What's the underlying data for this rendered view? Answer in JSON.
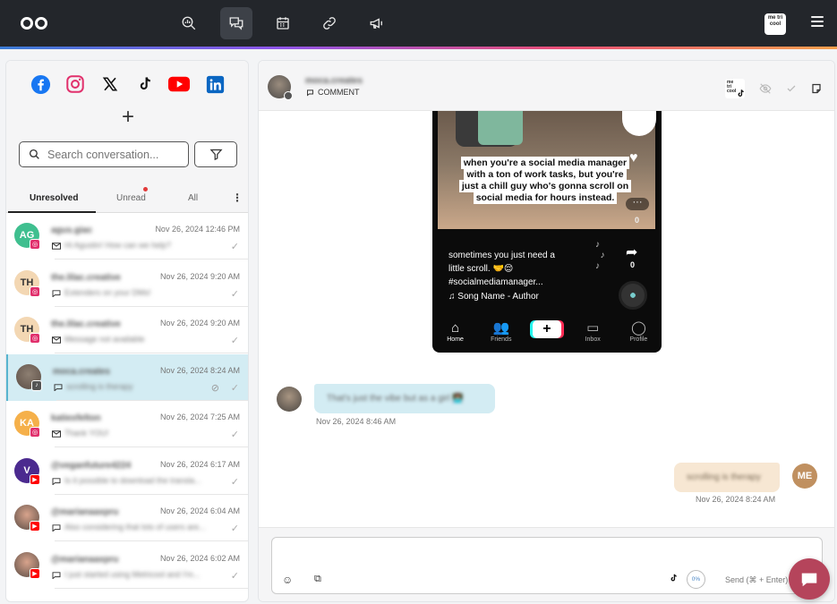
{
  "nav": {
    "items": [
      "search-analytics-icon",
      "inbox-icon",
      "calendar-icon",
      "link-icon",
      "megaphone-icon"
    ],
    "active": "inbox-icon",
    "brand_badge": "me tri cool"
  },
  "sidebar": {
    "networks": [
      "facebook-icon",
      "instagram-icon",
      "x-icon",
      "tiktok-icon",
      "youtube-icon",
      "linkedin-icon"
    ],
    "search_placeholder": "Search conversation...",
    "tabs": {
      "unresolved": "Unresolved",
      "unread": "Unread",
      "all": "All"
    },
    "conversations": [
      {
        "initials": "AG",
        "avatar_color": "#3fbf8f",
        "network": "instagram",
        "name": "agus.giac",
        "time": "Nov 26, 2024 12:46 PM",
        "type": "message",
        "preview": "Hi Agustin! How can we help?"
      },
      {
        "initials": "TH",
        "avatar_color": "#f3d7b3",
        "network": "instagram",
        "name": "the.lilac.creative",
        "time": "Nov 26, 2024 9:20 AM",
        "type": "comment",
        "preview": "Extenders on your DMs!"
      },
      {
        "initials": "TH",
        "avatar_color": "#f3d7b3",
        "network": "instagram",
        "name": "the.lilac.creative",
        "time": "Nov 26, 2024 9:20 AM",
        "type": "message",
        "preview": "Message not available"
      },
      {
        "initials": "",
        "avatar_color": "#8d7f72",
        "network": "tiktok",
        "name": "moca.creates",
        "time": "Nov 26, 2024 8:24 AM",
        "type": "comment",
        "preview": "scrolling is therapy"
      },
      {
        "initials": "KA",
        "avatar_color": "#f5b04a",
        "network": "instagram",
        "name": "katiexfelton",
        "time": "Nov 26, 2024 7:25 AM",
        "type": "message",
        "preview": "Thank YOU!"
      },
      {
        "initials": "V",
        "avatar_color": "#4b2a8f",
        "network": "youtube",
        "name": "@veganfuture4224",
        "time": "Nov 26, 2024 6:17 AM",
        "type": "comment",
        "preview": "Is it possible to download the transla..."
      },
      {
        "initials": "",
        "avatar_color": "#d8a38c",
        "network": "youtube",
        "name": "@marianaaxpru",
        "time": "Nov 26, 2024 6:04 AM",
        "type": "comment",
        "preview": "Also considering that lots of users are..."
      },
      {
        "initials": "",
        "avatar_color": "#d8a38c",
        "network": "youtube",
        "name": "@marianaaxpru",
        "time": "Nov 26, 2024 6:02 AM",
        "type": "comment",
        "preview": "I just started using Metricool and I'm..."
      }
    ]
  },
  "thread": {
    "name": "moca.creates",
    "type_label": "COMMENT",
    "post": {
      "overlay_caption": "when you're a social media manager with a ton of work tasks, but you're just a chill guy who's gonna scroll on social media for hours instead.",
      "likes": "0",
      "shares": "0",
      "description_line1": "sometimes you just need a",
      "description_line2": "little scroll. 🤝😌",
      "description_line3": "#socialmediamanager...",
      "song": "Song Name - Author",
      "nav": [
        "Home",
        "Friends",
        "+",
        "Inbox",
        "Profile"
      ]
    },
    "messages": [
      {
        "direction": "in",
        "text": "That's just the vibe but as a girl 👩🏽‍💻",
        "time": "Nov 26, 2024 8:46 AM"
      },
      {
        "direction": "out",
        "initials": "ME",
        "text": "scrolling is therapy",
        "time": "Nov 26, 2024 8:24 AM"
      }
    ]
  },
  "composer": {
    "char_percent": "0%",
    "send_hint": "Send (⌘ + Enter)"
  },
  "colors": {
    "topbar": "#23262b",
    "selected_row": "#d3ecf3",
    "incoming_bubble": "#d3ecf3",
    "outgoing_bubble": "#f7e7d3",
    "fab": "#b5445b"
  }
}
